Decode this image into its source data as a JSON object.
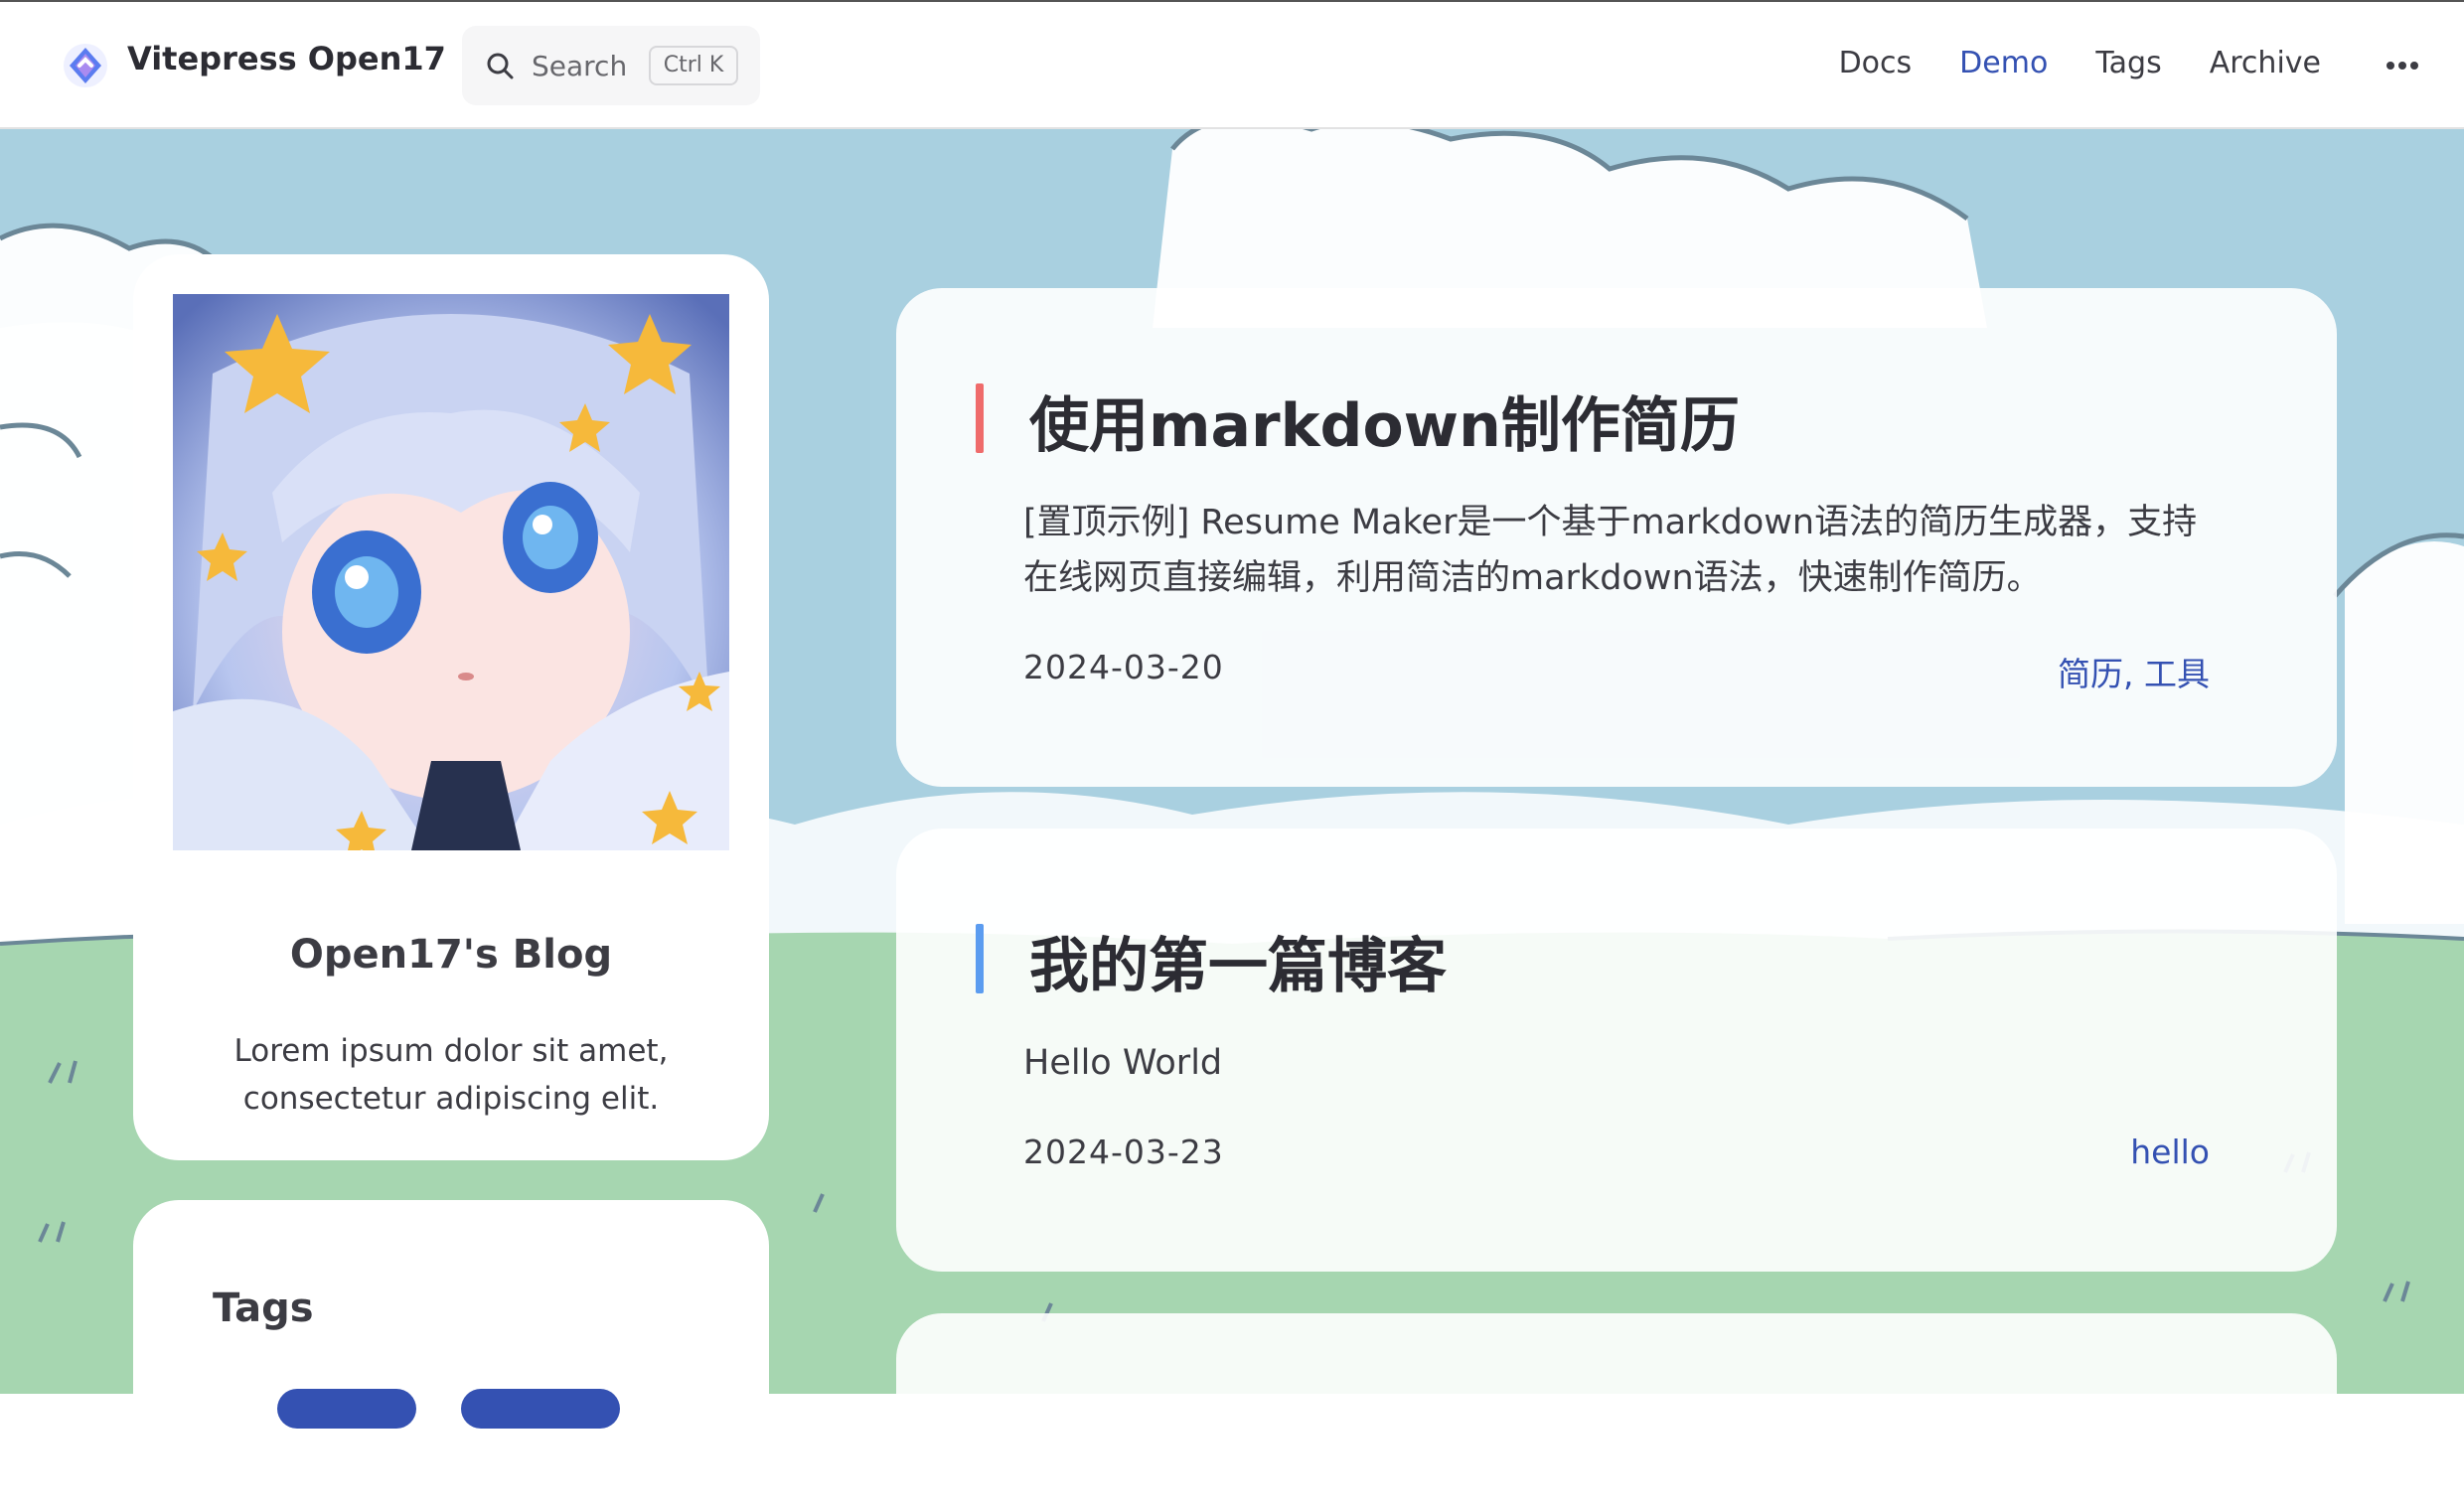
{
  "nav": {
    "site_title": "Vitepress Open17",
    "search_label": "Search",
    "search_shortcut": "Ctrl K",
    "links": [
      {
        "label": "Docs"
      },
      {
        "label": "Demo"
      },
      {
        "label": "Tags"
      },
      {
        "label": "Archive"
      }
    ],
    "more_icon": "ellipsis-icon",
    "accent_color": "#3451b2"
  },
  "profile": {
    "blog_name": "Open17's Blog",
    "description": "Lorem ipsum dolor sit amet, consectetur adipiscing elit."
  },
  "tags_panel": {
    "title": "Tags"
  },
  "posts": [
    {
      "title": "使用markdown制作简历",
      "excerpt": "[置顶示例] Resume Maker是一个基于markdown语法的简历生成器，支持在线网页直接编辑，利用简洁的markdown语法，快速制作简历。",
      "date": "2024-03-20",
      "tags": "简历, 工具",
      "bar_color": "#ef6b6b"
    },
    {
      "title": "我的第一篇博客",
      "excerpt": "Hello World",
      "date": "2024-03-23",
      "tags": "hello",
      "bar_color": "#5b9cf0"
    }
  ]
}
